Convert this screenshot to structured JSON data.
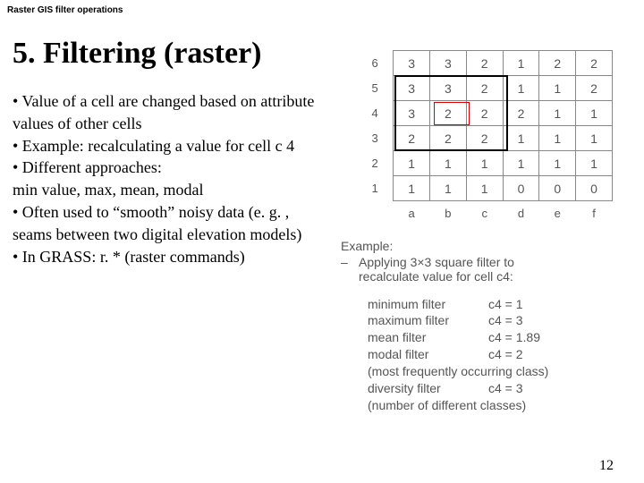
{
  "header": "Raster GIS filter operations",
  "title": "5. Filtering (raster)",
  "bullets": [
    "• Value of a cell are changed based on attribute values of other cells",
    "• Example: recalculating a value for cell c 4",
    "• Different approaches:",
    "min value, max, mean, modal",
    "• Often used to “smooth” noisy data (e. g. , seams between two digital elevation models)",
    "• In GRASS: r. * (raster commands)"
  ],
  "grid": {
    "row_labels": [
      "6",
      "5",
      "4",
      "3",
      "2",
      "1"
    ],
    "col_labels": [
      "a",
      "b",
      "c",
      "d",
      "e",
      "f"
    ],
    "rows": [
      [
        "3",
        "3",
        "2",
        "1",
        "2",
        "2"
      ],
      [
        "3",
        "3",
        "2",
        "1",
        "1",
        "2"
      ],
      [
        "3",
        "2",
        "2",
        "2",
        "1",
        "1"
      ],
      [
        "2",
        "2",
        "2",
        "1",
        "1",
        "1"
      ],
      [
        "1",
        "1",
        "1",
        "1",
        "1",
        "1"
      ],
      [
        "1",
        "1",
        "1",
        "0",
        "0",
        "0"
      ]
    ]
  },
  "example_label": "Example:",
  "example_line1": "Applying 3×3 square filter to",
  "example_line2": "recalculate value for cell c4:",
  "filters": [
    {
      "name": "minimum filter",
      "val": "c4 = 1",
      "note": ""
    },
    {
      "name": "maximum filter",
      "val": "c4 = 3",
      "note": ""
    },
    {
      "name": "mean filter",
      "val": "c4 = 1.89",
      "note": ""
    },
    {
      "name": "modal filter",
      "val": "c4 = 2",
      "note": "(most frequently occurring class)"
    },
    {
      "name": "diversity filter",
      "val": "c4 = 3",
      "note": "(number of different classes)"
    }
  ],
  "page_number": "12",
  "chart_data": {
    "type": "table",
    "title": "Raster grid with 3×3 filter window on cell c4",
    "columns": [
      "a",
      "b",
      "c",
      "d",
      "e",
      "f"
    ],
    "row_index": [
      "6",
      "5",
      "4",
      "3",
      "2",
      "1"
    ],
    "values": [
      [
        3,
        3,
        2,
        1,
        2,
        2
      ],
      [
        3,
        3,
        2,
        1,
        1,
        2
      ],
      [
        3,
        2,
        2,
        2,
        1,
        1
      ],
      [
        2,
        2,
        2,
        1,
        1,
        1
      ],
      [
        1,
        1,
        1,
        1,
        1,
        1
      ],
      [
        1,
        1,
        1,
        0,
        0,
        0
      ]
    ],
    "highlight_window": {
      "rows": [
        "5",
        "4",
        "3"
      ],
      "cols": [
        "b",
        "c",
        "d"
      ]
    },
    "highlight_cell": {
      "row": "4",
      "col": "c"
    },
    "filter_results": {
      "minimum": 1,
      "maximum": 3,
      "mean": 1.89,
      "modal": 2,
      "diversity": 3
    }
  }
}
